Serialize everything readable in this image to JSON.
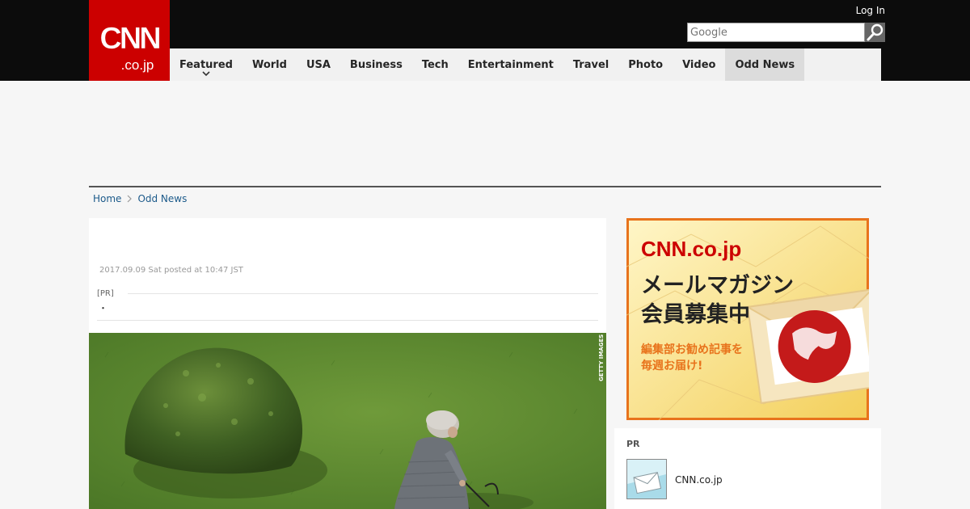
{
  "header": {
    "logo_text": "CNN.co.jp",
    "login_label": "Log In",
    "search_placeholder": "Google",
    "search_button_icon": "search-icon"
  },
  "nav": {
    "items": [
      {
        "label": "Featured",
        "has_dropdown": true
      },
      {
        "label": "World"
      },
      {
        "label": "USA"
      },
      {
        "label": "Business"
      },
      {
        "label": "Tech"
      },
      {
        "label": "Entertainment"
      },
      {
        "label": "Travel"
      },
      {
        "label": "Photo"
      },
      {
        "label": "Video"
      },
      {
        "label": "Odd News",
        "active": true
      }
    ]
  },
  "breadcrumb": {
    "items": [
      "Home",
      "Odd News"
    ]
  },
  "article": {
    "date": "2017.09.09 Sat posted at 10:47 JST",
    "pr_label": "[PR]",
    "pr_text": "・",
    "photo_credit": "GETTY IMAGES"
  },
  "sidebar": {
    "banner": {
      "logo_text": "CNN.co.jp",
      "headline_line1": "メールマガジン",
      "headline_line2": "会員募集中",
      "sub_line1": "編集部お勧め記事を",
      "sub_line2": "毎週お届け!"
    },
    "pr_box": {
      "title": "PR",
      "link_text": "CNN.co.jp",
      "thumb_icon": "mail-icon"
    }
  },
  "colors": {
    "brand_red": "#cc0000",
    "header_bg": "#0c0c0c",
    "nav_bg": "#f1f1f1",
    "link_blue": "#1c5a8a",
    "banner_orange": "#e8731c"
  }
}
